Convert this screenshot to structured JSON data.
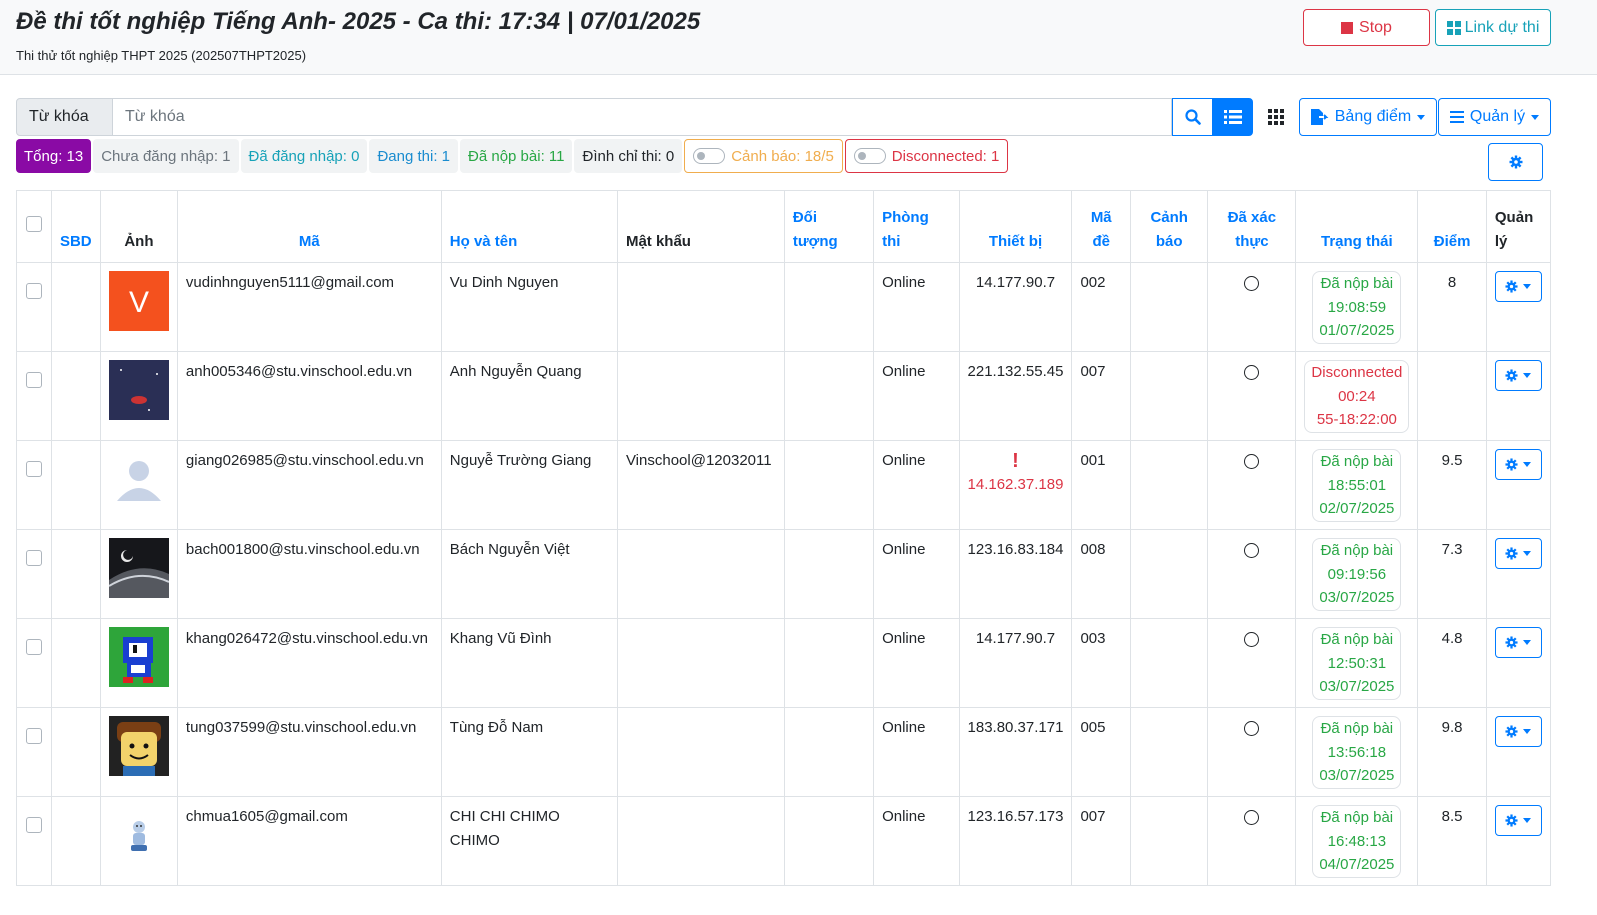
{
  "header": {
    "title": "Đề thi tốt nghiệp Tiếng Anh- 2025 - Ca thi: 17:34 | 07/01/2025",
    "subtitle": "Thi thử tốt nghiệp THPT 2025 (202507THPT2025)",
    "stop_label": "Stop",
    "link_label": "Link dự thi"
  },
  "search": {
    "label": "Từ khóa",
    "placeholder": "Từ khóa"
  },
  "toolbar": {
    "scores_label": "Bảng điểm",
    "manage_label": "Quản lý"
  },
  "badges": {
    "total": "Tổng: 13",
    "not_logged": "Chưa đăng nhập: 1",
    "logged": "Đã đăng nhập: 0",
    "doing": "Đang thi: 1",
    "submitted": "Đã nộp bài: 11",
    "suspended": "Đình chỉ thi: 0",
    "warning": "Cảnh báo: 18/5",
    "disconnected": "Disconnected: 1"
  },
  "table": {
    "headers": {
      "sbd": "SBD",
      "photo": "Ảnh",
      "code": "Mã",
      "name": "Họ và tên",
      "password": "Mật khẩu",
      "group_1": "Đối",
      "group_2": "tượng",
      "room_1": "Phòng",
      "room_2": "thi",
      "device": "Thiết bị",
      "exam_1": "Mã",
      "exam_2": "đề",
      "warn_1": "Cảnh",
      "warn_2": "báo",
      "verified_1": "Đã xác",
      "verified_2": "thực",
      "status": "Trạng thái",
      "score": "Điểm",
      "manage_1": "Quản",
      "manage_2": "lý"
    },
    "rows": [
      {
        "code": "vudinhnguyen5111@gmail.com",
        "name_1": "Vu Dinh Nguyen",
        "name_2": "",
        "password": "",
        "room": "Online",
        "device": "14.177.90.7",
        "exam": "002",
        "status_1": "Đã nộp bài",
        "status_2": "19:08:59",
        "status_3": "01/07/2025",
        "score": "8",
        "avatar_letter": "V"
      },
      {
        "code": "anh005346@stu.vinschool.edu.vn",
        "name_1": "Anh Nguyễn Quang",
        "name_2": "",
        "password": "",
        "room": "Online",
        "device": "221.132.55.45",
        "exam": "007",
        "status_1": "Disconnected",
        "status_2": "00:24",
        "status_3": "55-18:22:00",
        "score": ""
      },
      {
        "code": "giang026985@stu.vinschool.edu.vn",
        "name_1": "Nguyễ Trường Giang",
        "name_2": "",
        "password": "Vinschool@12032011",
        "room": "Online",
        "device_alert": "!",
        "device": "14.162.37.189",
        "exam": "001",
        "status_1": "Đã nộp bài",
        "status_2": "18:55:01",
        "status_3": "02/07/2025",
        "score": "9.5"
      },
      {
        "code": "bach001800@stu.vinschool.edu.vn",
        "name_1": "Bách Nguyễn Việt",
        "name_2": "",
        "password": "",
        "room": "Online",
        "device": "123.16.83.184",
        "exam": "008",
        "status_1": "Đã nộp bài",
        "status_2": "09:19:56",
        "status_3": "03/07/2025",
        "score": "7.3"
      },
      {
        "code": "khang026472@stu.vinschool.edu.vn",
        "name_1": "Khang Vũ Đình",
        "name_2": "",
        "password": "",
        "room": "Online",
        "device": "14.177.90.7",
        "exam": "003",
        "status_1": "Đã nộp bài",
        "status_2": "12:50:31",
        "status_3": "03/07/2025",
        "score": "4.8"
      },
      {
        "code": "tung037599@stu.vinschool.edu.vn",
        "name_1": "Tùng Đỗ Nam",
        "name_2": "",
        "password": "",
        "room": "Online",
        "device": "183.80.37.171",
        "exam": "005",
        "status_1": "Đã nộp bài",
        "status_2": "13:56:18",
        "status_3": "03/07/2025",
        "score": "9.8"
      },
      {
        "code": "chmua1605@gmail.com",
        "name_1": "CHI CHI CHIMO",
        "name_2": "CHIMO",
        "password": "",
        "room": "Online",
        "device": "123.16.57.173",
        "exam": "007",
        "status_1": "Đã nộp bài",
        "status_2": "16:48:13",
        "status_3": "04/07/2025",
        "score": "8.5"
      }
    ]
  },
  "colors": {
    "primary": "#007bff",
    "danger": "#dc3545",
    "success": "#28a745",
    "info": "#17a2b8",
    "total_badge": "#8a0aa5",
    "warning": "#f0ad4e"
  }
}
